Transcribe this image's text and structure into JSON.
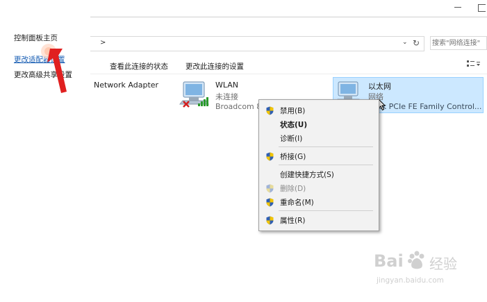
{
  "left_nav": {
    "home": "控制面板主页",
    "adapter_settings": "更改适配器设置",
    "sharing_settings": "更改高级共享设置"
  },
  "address": {
    "chevron": ">",
    "search_placeholder": "搜索\"网络连接\""
  },
  "commands": {
    "view_status": "查看此连接的状态",
    "change_settings": "更改此连接的设置"
  },
  "adapters": {
    "partial": {
      "name": "Network Adapter"
    },
    "wlan": {
      "name": "WLAN",
      "status": "未连接",
      "device": "Broadcom 8"
    },
    "ethernet": {
      "name": "以太网",
      "status": "网络",
      "device": "ek PCIe FE Family Control..."
    }
  },
  "context_menu": {
    "disable": "禁用(B)",
    "status": "状态(U)",
    "diagnose": "诊断(I)",
    "bridge": "桥接(G)",
    "shortcut": "创建快捷方式(S)",
    "delete": "删除(D)",
    "rename": "重命名(M)",
    "properties": "属性(R)"
  },
  "watermark": {
    "brand": "Bai",
    "brand_tail": "经验",
    "url": "jingyan.baidu.com"
  },
  "colors": {
    "link": "#1a5fb4",
    "selection_fill": "#cce8ff",
    "selection_border": "#99d1ff",
    "annotation_red": "#e02020",
    "shield_blue": "#2f5fb3",
    "shield_yellow": "#f2c400"
  }
}
